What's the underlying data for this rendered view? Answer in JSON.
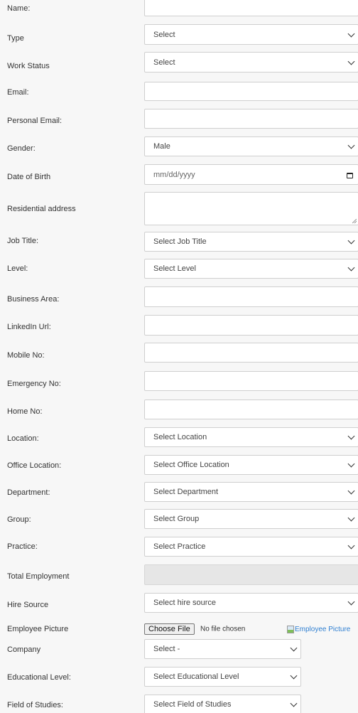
{
  "fields": [
    {
      "id": "name",
      "label": "Name:",
      "kind": "text",
      "value": ""
    },
    {
      "id": "type",
      "label": "Type",
      "kind": "select",
      "value": "Select"
    },
    {
      "id": "work-status",
      "label": "Work Status",
      "kind": "select",
      "value": "Select"
    },
    {
      "id": "email",
      "label": "Email:",
      "kind": "text",
      "value": ""
    },
    {
      "id": "personal-email",
      "label": "Personal Email:",
      "kind": "text",
      "value": ""
    },
    {
      "id": "gender",
      "label": "Gender:",
      "kind": "select",
      "value": "Male"
    },
    {
      "id": "date-of-birth",
      "label": "Date of Birth",
      "kind": "date",
      "placeholder": "mm/dd/yyyy"
    },
    {
      "id": "residential-address",
      "label": "Residential address",
      "kind": "textarea",
      "value": ""
    },
    {
      "id": "job-title",
      "label": "Job Title:",
      "kind": "select",
      "value": "Select Job Title"
    },
    {
      "id": "level",
      "label": "Level:",
      "kind": "select",
      "value": "Select Level"
    },
    {
      "id": "business-area",
      "label": "Business Area:",
      "kind": "text",
      "value": ""
    },
    {
      "id": "linkedin-url",
      "label": "LinkedIn Url:",
      "kind": "text",
      "value": ""
    },
    {
      "id": "mobile-no",
      "label": "Mobile No:",
      "kind": "text",
      "value": ""
    },
    {
      "id": "emergency-no",
      "label": "Emergency No:",
      "kind": "text",
      "value": ""
    },
    {
      "id": "home-no",
      "label": "Home No:",
      "kind": "text",
      "value": ""
    },
    {
      "id": "location",
      "label": "Location:",
      "kind": "select",
      "value": "Select Location"
    },
    {
      "id": "office-location",
      "label": "Office Location:",
      "kind": "select",
      "value": "Select Office Location"
    },
    {
      "id": "department",
      "label": "Department:",
      "kind": "select",
      "value": "Select Department"
    },
    {
      "id": "group",
      "label": "Group:",
      "kind": "select",
      "value": "Select Group"
    },
    {
      "id": "practice",
      "label": "Practice:",
      "kind": "select",
      "value": "Select Practice"
    },
    {
      "id": "total-employment",
      "label": "Total Employment",
      "kind": "disabled",
      "value": ""
    },
    {
      "id": "hire-source",
      "label": "Hire Source",
      "kind": "select",
      "value": "Select hire source"
    },
    {
      "id": "employee-picture",
      "label": "Employee Picture",
      "kind": "file",
      "button": "Choose File",
      "status": "No file chosen",
      "image_alt": "Employee Picture"
    },
    {
      "id": "company",
      "label": "Company",
      "kind": "select-short",
      "value": "Select -"
    },
    {
      "id": "educational-level",
      "label": "Educational Level:",
      "kind": "select-short",
      "value": "Select Educational Level"
    },
    {
      "id": "field-of-studies",
      "label": "Field of Studies:",
      "kind": "select-short",
      "value": "Select Field of Studies"
    }
  ]
}
